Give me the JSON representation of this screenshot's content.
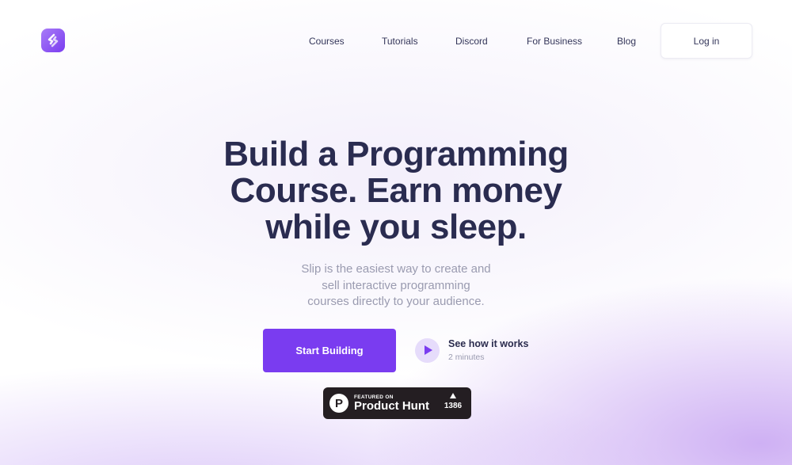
{
  "brand": {
    "logo_icon": "slip-logo-icon",
    "accent": "#7a3cf0"
  },
  "nav": {
    "links": [
      "Courses",
      "Tutorials",
      "Discord",
      "For Business",
      "Blog"
    ],
    "login_label": "Log in"
  },
  "hero": {
    "headline_lines": [
      "Build a Programming",
      "Course. Earn money",
      "while you sleep."
    ],
    "sub_lines": [
      "Slip is the easiest way to create and",
      "sell interactive programming",
      "courses directly to your audience."
    ],
    "cta_label": "Start Building",
    "video_title": "See how it works",
    "video_duration": "2 minutes",
    "play_icon": "play-icon"
  },
  "product_hunt": {
    "featured_label": "FEATURED ON",
    "name": "Product Hunt",
    "logo_letter": "P",
    "upvotes": "1386"
  }
}
